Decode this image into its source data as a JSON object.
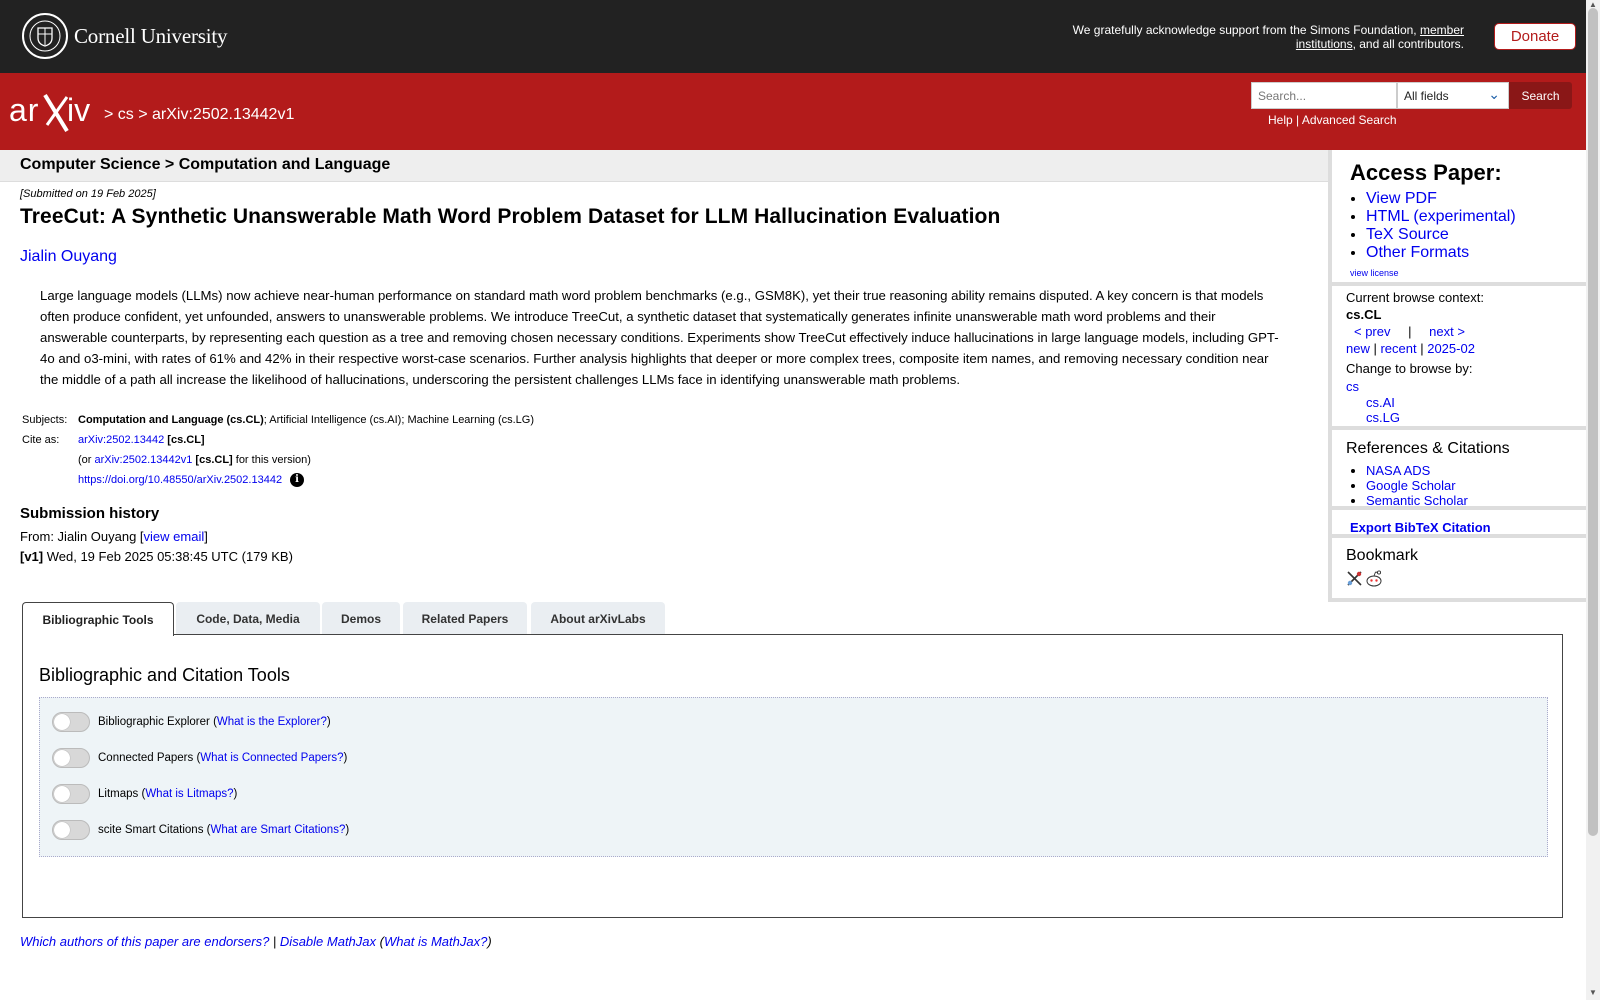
{
  "topbar": {
    "university": "Cornell University",
    "ack_text": "We gratefully acknowledge support from the Simons Foundation,",
    "ack_link": "member institutions",
    "ack_tail": ", and all contributors.",
    "donate_label": "Donate"
  },
  "header": {
    "logo_text": "arXiv",
    "crumbs": "> cs > arXiv:2502.13442v1",
    "search_placeholder": "Search...",
    "search_field": "All fields",
    "search_button": "Search",
    "help": "Help",
    "sep": " | ",
    "advanced": "Advanced Search"
  },
  "subject_bar": "Computer Science > Computation and Language",
  "paper": {
    "submitted": "[Submitted on 19 Feb 2025]",
    "title": "TreeCut: A Synthetic Unanswerable Math Word Problem Dataset for LLM Hallucination Evaluation",
    "author": "Jialin Ouyang",
    "abstract": "Large language models (LLMs) now achieve near-human performance on standard math word problem benchmarks (e.g., GSM8K), yet their true reasoning ability remains disputed. A key concern is that models often produce confident, yet unfounded, answers to unanswerable problems. We introduce TreeCut, a synthetic dataset that systematically generates infinite unanswerable math word problems and their answerable counterparts, by representing each question as a tree and removing chosen necessary conditions. Experiments show TreeCut effectively induce hallucinations in large language models, including GPT-4o and o3-mini, with rates of 61% and 42% in their respective worst-case scenarios. Further analysis highlights that deeper or more complex trees, composite item names, and removing necessary condition near the middle of a path all increase the likelihood of hallucinations, underscoring the persistent challenges LLMs face in identifying unanswerable math problems."
  },
  "meta": {
    "subjects_label": "Subjects:",
    "subjects_primary": "Computation and Language (cs.CL)",
    "subjects_rest": "; Artificial Intelligence (cs.AI); Machine Learning (cs.LG)",
    "cite_label": "Cite as:",
    "cite_id": "arXiv:2502.13442",
    "cite_cat": "[cs.CL]",
    "or_prefix": "(or ",
    "or_id": "arXiv:2502.13442v1",
    "or_cat": "[cs.CL]",
    "or_suffix": " for this version)",
    "doi": "https://doi.org/10.48550/arXiv.2502.13442"
  },
  "history": {
    "heading": "Submission history",
    "from_prefix": "From: Jialin Ouyang [",
    "view_email": "view email",
    "from_suffix": "]",
    "v1_label": "[v1]",
    "v1_text": " Wed, 19 Feb 2025 05:38:45 UTC (179 KB)"
  },
  "sidebar": {
    "access_heading": "Access Paper:",
    "access_links": [
      "View PDF",
      "HTML (experimental)",
      "TeX Source",
      "Other Formats"
    ],
    "view_license": "view license",
    "ctx_label": "Current browse context:",
    "ctx_value": "cs.CL",
    "prev": "< prev",
    "pipe": "|",
    "next": "next >",
    "new": "new",
    "recent": "recent",
    "month": "2025-02",
    "change_label": "Change to browse by:",
    "browse_cs": "cs",
    "browse_ai": "cs.AI",
    "browse_lg": "cs.LG",
    "refs_heading": "References & Citations",
    "refs_links": [
      "NASA ADS",
      "Google Scholar",
      "Semantic Scholar"
    ],
    "bibtex": "Export BibTeX Citation",
    "bookmark_heading": "Bookmark"
  },
  "tabs": [
    "Bibliographic Tools",
    "Code, Data, Media",
    "Demos",
    "Related Papers",
    "About arXivLabs"
  ],
  "panel": {
    "heading": "Bibliographic and Citation Tools",
    "tools": [
      {
        "name": "Bibliographic Explorer",
        "help": "What is the Explorer?"
      },
      {
        "name": "Connected Papers",
        "help": "What is Connected Papers?"
      },
      {
        "name": "Litmaps",
        "help": "What is Litmaps?"
      },
      {
        "name": "scite Smart Citations",
        "help": "What are Smart Citations?"
      }
    ]
  },
  "footer": {
    "endorsers": "Which authors of this paper are endorsers?",
    "sep": " | ",
    "disable_mathjax": "Disable MathJax",
    "what_mathjax": "What is MathJax?"
  },
  "colors": {
    "arxiv_red": "#b31b1b",
    "topbar": "#222222",
    "link": "#0000ee"
  }
}
